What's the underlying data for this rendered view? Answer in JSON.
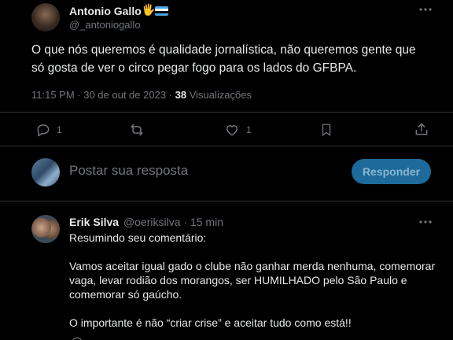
{
  "main_tweet": {
    "author_name": "Antonio Gallo",
    "author_handle": "@_antoniogallo",
    "emoji": "🖐",
    "text_line1": "O que nós queremos é qualidade jornalística, não queremos gente que",
    "text_line2": "só gosta de ver o circo pegar fogo para os lados do  GFBPA.",
    "timestamp": "11:15 PM · 30 de out de 2023 · ",
    "views_count": "38",
    "views_label": " Visualizações",
    "reply_count": "1",
    "retweet_count": "",
    "like_count": "1"
  },
  "reply_box": {
    "placeholder": "Postar sua resposta",
    "button_label": "Responder"
  },
  "reply": {
    "author_name": "Erik Silva",
    "author_handle": "@oeriksilva",
    "time": " · 15 min",
    "line1": "Resumindo seu comentário:",
    "para1_line1": "Vamos aceitar igual gado o clube não ganhar merda nenhuma, comemorar",
    "para1_line2": "vaga, levar rodião dos morangos, ser HUMILHADO pelo São Paulo e",
    "para1_line3": "comemorar só gaúcho.",
    "line_last": "O importante é não “criar crise” e aceitar tudo como está!!"
  },
  "colors": {
    "background": "#000000",
    "text": "#e7e9ea",
    "muted": "#71767b",
    "button": "#1d6a9b",
    "divider": "#2f3336"
  }
}
